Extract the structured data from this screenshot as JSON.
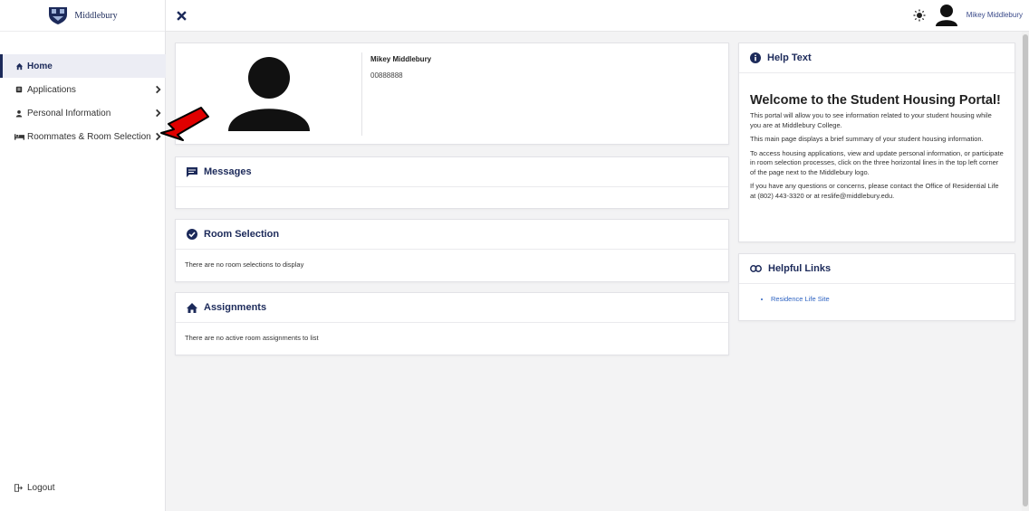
{
  "brand": {
    "name": "Middlebury"
  },
  "sidebar": {
    "items": [
      {
        "label": "Home",
        "icon": "home-icon",
        "active": true
      },
      {
        "label": "Applications",
        "icon": "clipboard-icon",
        "chevron": true
      },
      {
        "label": "Personal Information",
        "icon": "person-icon",
        "chevron": true
      },
      {
        "label": "Roommates & Room Selection",
        "icon": "bed-icon",
        "chevron": true
      }
    ],
    "logout": "Logout"
  },
  "topbar": {
    "user_name": "Mikey Middlebury"
  },
  "profile": {
    "name": "Mikey Middlebury",
    "id": "00888888"
  },
  "cards": {
    "messages": {
      "title": "Messages"
    },
    "room_selection": {
      "title": "Room Selection",
      "empty_text": "There are no room selections to display"
    },
    "assignments": {
      "title": "Assignments",
      "empty_text": "There are no active room assignments to list"
    }
  },
  "help": {
    "header": "Help Text",
    "title": "Welcome to the Student Housing Portal!",
    "paragraphs": [
      "This portal will allow you to see information related to your student housing while you are at Middlebury College.",
      "This main page displays a brief summary of your student housing information.",
      "To access housing applications, view and update personal information, or participate in room selection processes, click on the three horizontal lines in the top left corner of the page next to the Middlebury logo.",
      "If you have any questions or concerns, please contact the Office of Residential Life at (802) 443-3320 or at reslife@middlebury.edu."
    ]
  },
  "links": {
    "header": "Helpful Links",
    "items": [
      "Residence Life Site"
    ]
  },
  "colors": {
    "brand_navy": "#1c2a5a",
    "link_blue": "#2e63c2",
    "annotation_red": "#e00000"
  }
}
